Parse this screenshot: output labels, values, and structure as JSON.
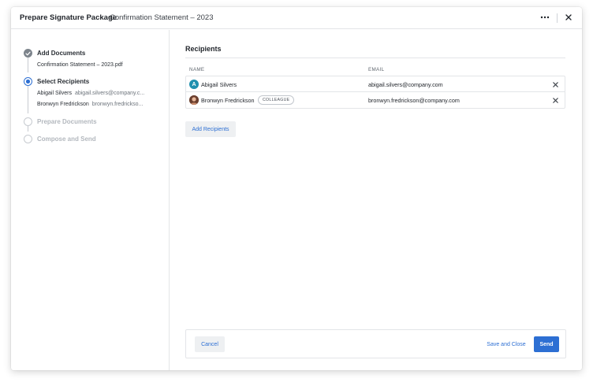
{
  "header": {
    "title": "Prepare Signature Package",
    "subtitle": "Confirmation Statement – 2023",
    "more_icon": "ellipsis-icon",
    "close_icon": "close-icon"
  },
  "steps": [
    {
      "label": "Add Documents",
      "status": "done",
      "details": [
        {
          "name": "Confirmation Statement – 2023.pdf",
          "extra": ""
        }
      ]
    },
    {
      "label": "Select Recipients",
      "status": "active",
      "details": [
        {
          "name": "Abigail Silvers",
          "extra": "abigail.silvers@company.c..."
        },
        {
          "name": "Bronwyn Fredrickson",
          "extra": "bronwyn.fredrickso..."
        }
      ]
    },
    {
      "label": "Prepare Documents",
      "status": "pending",
      "details": []
    },
    {
      "label": "Compose and Send",
      "status": "pending",
      "details": []
    }
  ],
  "main": {
    "section_title": "Recipients",
    "columns": {
      "name": "NAME",
      "email": "EMAIL"
    },
    "recipients": [
      {
        "name": "Abigail Silvers",
        "email": "abigail.silvers@company.com",
        "avatar": "A",
        "avatar_type": "letter",
        "badge": ""
      },
      {
        "name": "Bronwyn Fredrickson",
        "email": "bronwyn.fredrickson@company.com",
        "avatar": "",
        "avatar_type": "photo",
        "badge": "COLLEAGUE"
      }
    ],
    "add_label": "Add Recipients"
  },
  "footer": {
    "cancel_label": "Cancel",
    "save_label": "Save and Close",
    "send_label": "Send"
  },
  "colors": {
    "accent": "#2d6fd3",
    "avatar_letter_bg": "#1f8fae",
    "done_step": "#7d848c",
    "pending_step": "#b3b8be"
  }
}
